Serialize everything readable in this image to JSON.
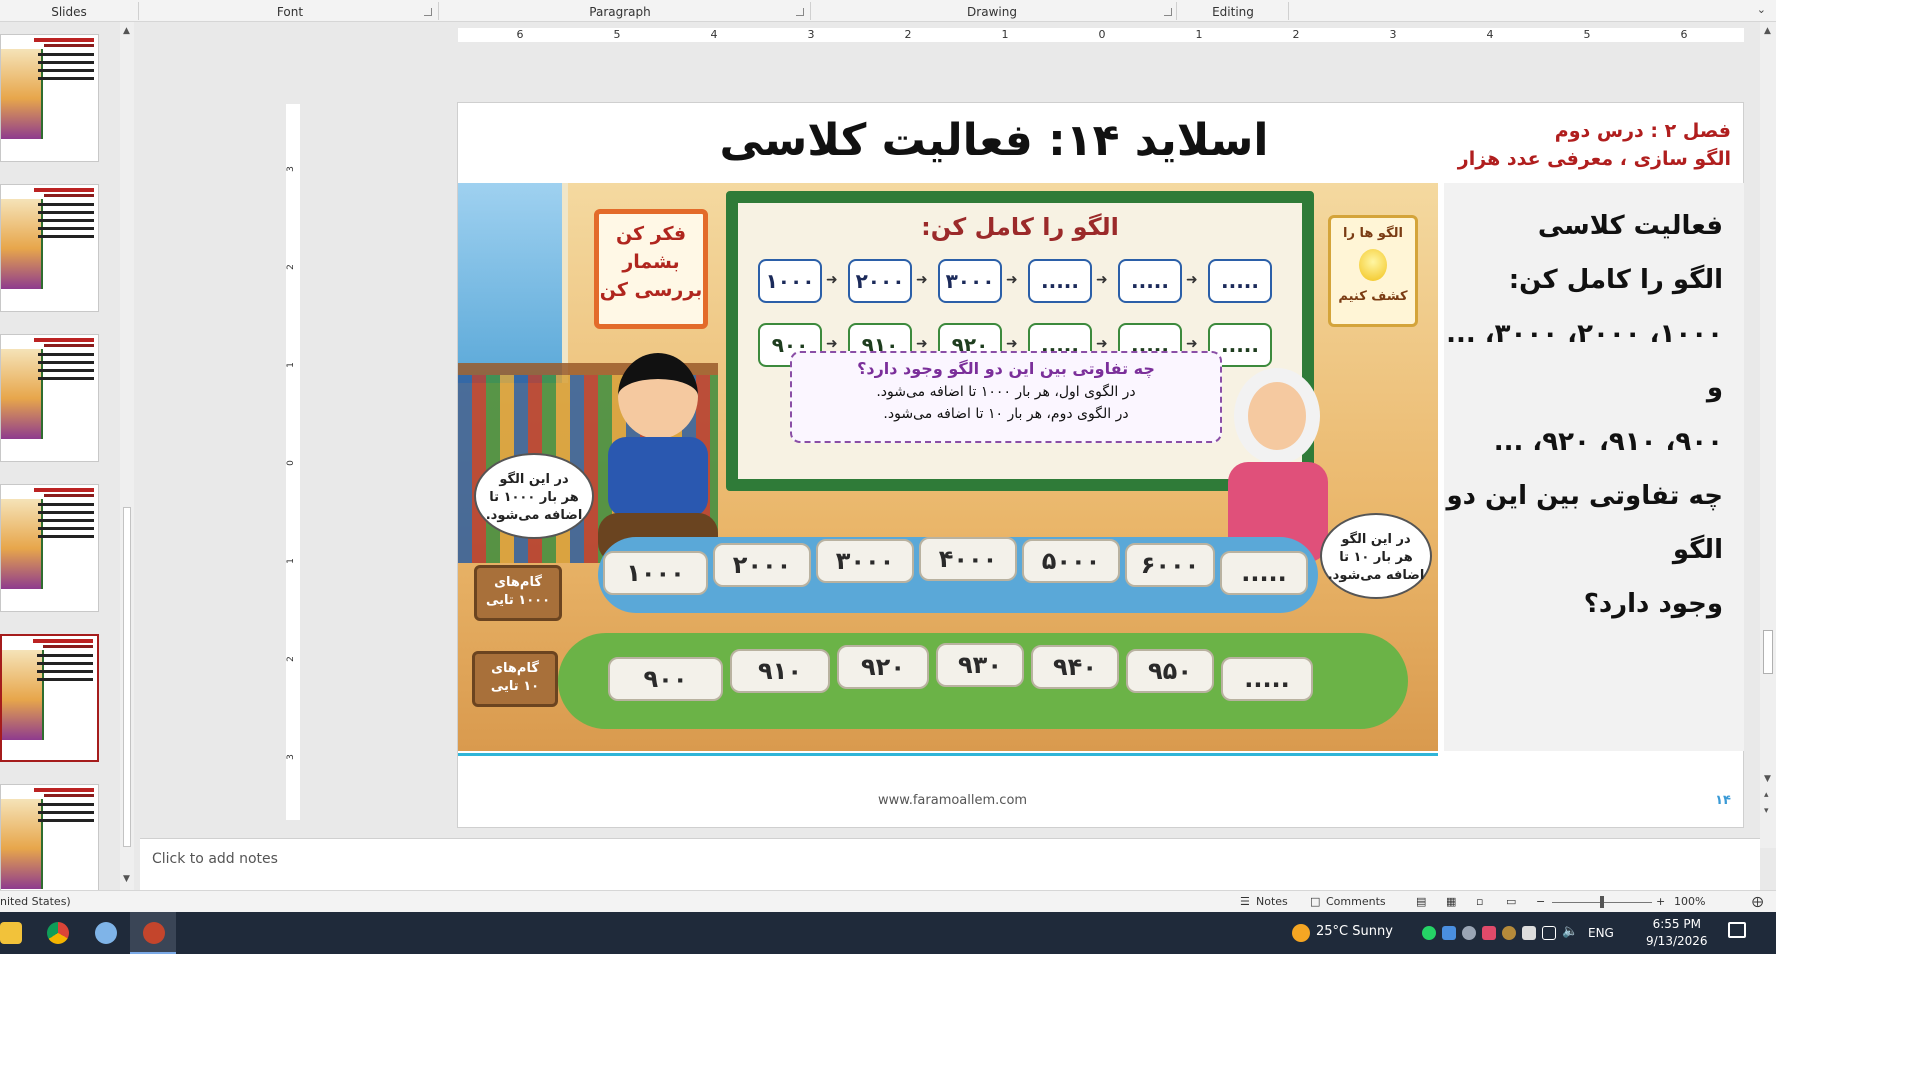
{
  "ribbon": {
    "groups": [
      "Slides",
      "Font",
      "Paragraph",
      "Drawing",
      "Editing"
    ]
  },
  "ruler": {
    "h_numbers": [
      "6",
      "5",
      "4",
      "3",
      "2",
      "1",
      "0",
      "1",
      "2",
      "3",
      "4",
      "5",
      "6"
    ],
    "v_numbers": [
      "3",
      "2",
      "1",
      "0",
      "1",
      "2",
      "3"
    ]
  },
  "slide": {
    "title": "اسلاید ۱۴: فعالیت کلاسی",
    "chapter_line1": "فصل ۲ : درس دوم",
    "chapter_line2": "الگو سازی ، معرفی عدد هزار",
    "body": {
      "line1": "فعالیت کلاسی",
      "line2": "الگو را کامل کن:",
      "line3": "۱۰۰۰، ۲۰۰۰، ۳۰۰۰، ...",
      "line4": "و",
      "line5": "۹۰۰، ۹۱۰، ۹۲۰، ...",
      "line6": "چه تفاوتی بین این دو الگو",
      "line7": "وجود دارد؟"
    },
    "footer_url": "www.faramoallem.com",
    "page_number": "۱۴",
    "picture": {
      "board_title": "الگو را کامل کن:",
      "row1": [
        "۱۰۰۰",
        "۲۰۰۰",
        "۳۰۰۰",
        ".....",
        ".....",
        "....."
      ],
      "row2": [
        "۹۰۰",
        "۹۱۰",
        "۹۲۰",
        ".....",
        ".....",
        "....."
      ],
      "question": "چه تفاوتی بین این دو الگو وجود دارد؟",
      "answer1": "در الگوی اول، هر بار ۱۰۰۰ تا اضافه می‌شود.",
      "answer2": "در الگوی دوم، هر بار ۱۰ تا اضافه می‌شود.",
      "sign_left": [
        "فکر کن",
        "بشمار",
        "بررسی کن"
      ],
      "sign_right_top": "الگو ها را",
      "sign_right_bottom": "کشف کنیم",
      "bubble_left": [
        "در این الگو",
        "هر بار ۱۰۰۰ تا",
        "اضافه می‌شود."
      ],
      "bubble_right": [
        "در این الگو",
        "هر بار ۱۰ تا",
        "اضافه می‌شود."
      ],
      "wood_top": [
        "گام‌های",
        "۱۰۰۰ تایی"
      ],
      "wood_bottom": [
        "گام‌های",
        "۱۰ تایی"
      ],
      "path1": [
        "۱۰۰۰",
        "۲۰۰۰",
        "۳۰۰۰",
        "۴۰۰۰",
        "۵۰۰۰",
        "۶۰۰۰",
        "....."
      ],
      "path2": [
        "۹۰۰",
        "۹۱۰",
        "۹۲۰",
        "۹۳۰",
        "۹۴۰",
        "۹۵۰",
        "....."
      ]
    }
  },
  "notes": {
    "placeholder": "Click to add notes"
  },
  "status": {
    "language": "nited States)",
    "notes_label": "Notes",
    "comments_label": "Comments",
    "zoom": "100%",
    "zoom_level": 1.0
  },
  "taskbar": {
    "weather": "25°C  Sunny",
    "lang": "ENG",
    "time": "6:55 PM",
    "date": "9/13/2026"
  }
}
